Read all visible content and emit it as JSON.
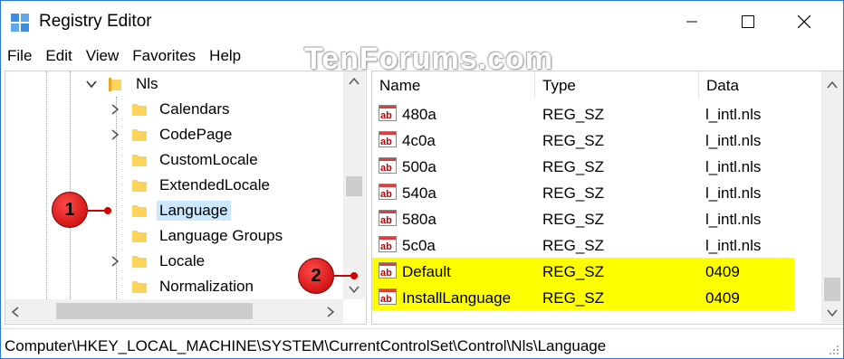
{
  "window": {
    "title": "Registry Editor",
    "min_icon": "minimize-icon",
    "max_icon": "maximize-icon",
    "close_icon": "close-icon"
  },
  "menu": {
    "items": [
      "File",
      "Edit",
      "View",
      "Favorites",
      "Help"
    ]
  },
  "watermark": "TenForums.com",
  "tree": {
    "parent": {
      "label": "Nls",
      "expanded": true
    },
    "children": [
      {
        "label": "Calendars",
        "expandable": true
      },
      {
        "label": "CodePage",
        "expandable": true
      },
      {
        "label": "CustomLocale",
        "expandable": false
      },
      {
        "label": "ExtendedLocale",
        "expandable": false
      },
      {
        "label": "Language",
        "expandable": false,
        "selected": true
      },
      {
        "label": "Language Groups",
        "expandable": false
      },
      {
        "label": "Locale",
        "expandable": true
      },
      {
        "label": "Normalization",
        "expandable": false
      }
    ]
  },
  "list": {
    "columns": [
      "Name",
      "Type",
      "Data"
    ],
    "rows": [
      {
        "name": "480a",
        "type": "REG_SZ",
        "data": "l_intl.nls",
        "highlighted": false
      },
      {
        "name": "4c0a",
        "type": "REG_SZ",
        "data": "l_intl.nls",
        "highlighted": false
      },
      {
        "name": "500a",
        "type": "REG_SZ",
        "data": "l_intl.nls",
        "highlighted": false
      },
      {
        "name": "540a",
        "type": "REG_SZ",
        "data": "l_intl.nls",
        "highlighted": false
      },
      {
        "name": "580a",
        "type": "REG_SZ",
        "data": "l_intl.nls",
        "highlighted": false
      },
      {
        "name": "5c0a",
        "type": "REG_SZ",
        "data": "l_intl.nls",
        "highlighted": false
      },
      {
        "name": "Default",
        "type": "REG_SZ",
        "data": "0409",
        "highlighted": true
      },
      {
        "name": "InstallLanguage",
        "type": "REG_SZ",
        "data": "0409",
        "highlighted": true
      }
    ]
  },
  "callouts": [
    "1",
    "2"
  ],
  "status": "Computer\\HKEY_LOCAL_MACHINE\\SYSTEM\\CurrentControlSet\\Control\\Nls\\Language",
  "colors": {
    "highlight": "#ffff00",
    "selection": "#cce8ff",
    "callout": "#d00000",
    "border": "#2b78d4"
  }
}
